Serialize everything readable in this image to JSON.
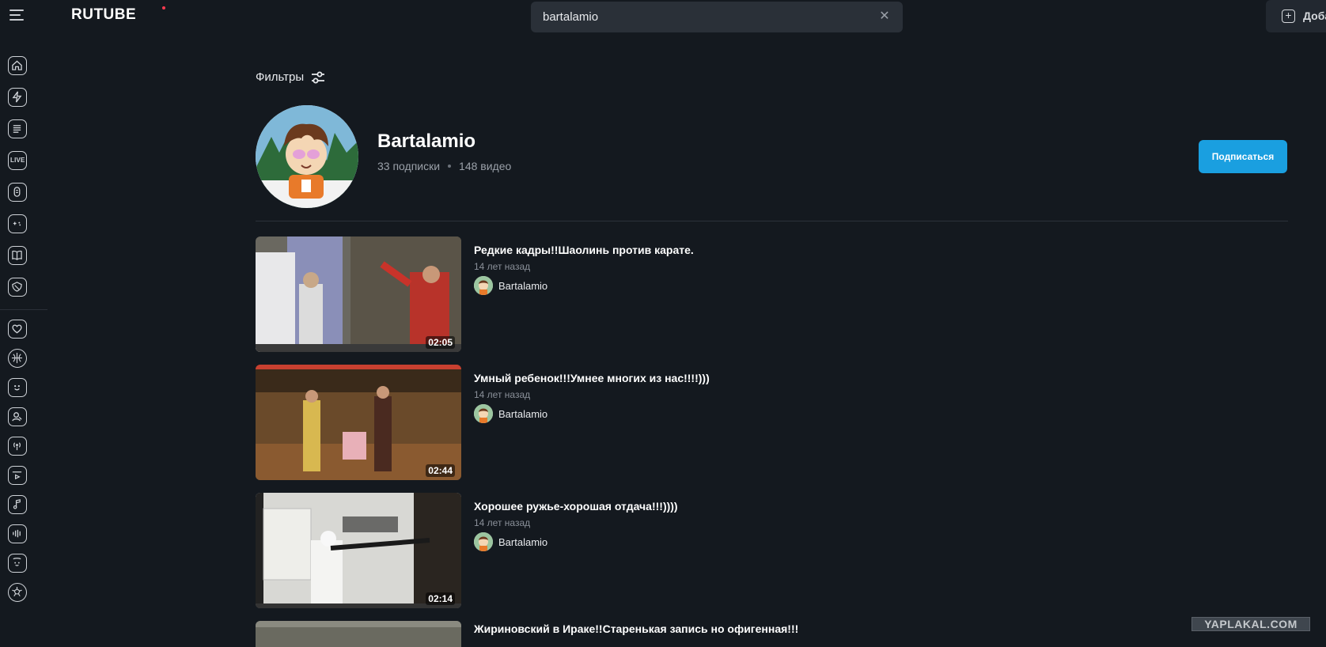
{
  "header": {
    "logo": "RUTUBE",
    "search_value": "bartalamio",
    "add_label": "Доба"
  },
  "filters": {
    "label": "Фильтры"
  },
  "channel": {
    "name": "Bartalamio",
    "subscribers": "33 подписки",
    "videos": "148 видео",
    "subscribe_label": "Подписаться"
  },
  "videos": [
    {
      "title": "Редкие кадры!!Шаолинь против карате.",
      "date": "14 лет назад",
      "author": "Bartalamio",
      "duration": "02:05"
    },
    {
      "title": "Умный ребенок!!!Умнее многих из нас!!!!)))",
      "date": "14 лет назад",
      "author": "Bartalamio",
      "duration": "02:44"
    },
    {
      "title": "Хорошее ружье-хорошая отдача!!!))))",
      "date": "14 лет назад",
      "author": "Bartalamio",
      "duration": "02:14"
    },
    {
      "title": "Жириновский в Ираке!!Старенькая запись но офигенная!!!",
      "date": "",
      "author": "",
      "duration": ""
    }
  ],
  "sidebar": {
    "live_label": "LIVE"
  },
  "watermark": "YAPLAKAL.COM",
  "icons": [
    "menu-icon",
    "home-icon",
    "lightning-icon",
    "news-icon",
    "live-icon",
    "podcast-icon",
    "gamepad-icon",
    "book-icon",
    "shield-icon",
    "heart-icon",
    "basketball-icon",
    "smile-icon",
    "person-icon",
    "broadcast-icon",
    "video-icon",
    "music-icon",
    "audio-icon",
    "kids-icon",
    "sport-icon"
  ]
}
